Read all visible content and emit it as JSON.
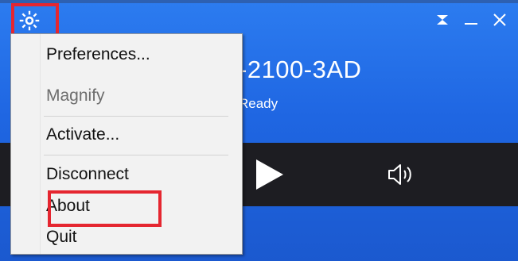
{
  "app": {
    "title": "-2100-3AD",
    "status": "Ready"
  },
  "menu": {
    "items": [
      {
        "label": "Preferences...",
        "enabled": true
      },
      {
        "label": "Magnify",
        "enabled": false
      },
      {
        "label": "Activate...",
        "enabled": true
      },
      {
        "label": "Disconnect",
        "enabled": true
      },
      {
        "label": "About",
        "enabled": true
      },
      {
        "label": "Quit",
        "enabled": true
      }
    ]
  },
  "icons": {
    "settings": "gear-icon",
    "collapse": "collapse-icon",
    "minimize": "minimize-icon",
    "close": "close-icon",
    "play": "play-icon",
    "volume": "volume-icon"
  },
  "colors": {
    "background": "#1f66e2",
    "control_bar": "#1d1d22",
    "highlight": "#e52630",
    "menu_bg": "#f2f2f2"
  }
}
